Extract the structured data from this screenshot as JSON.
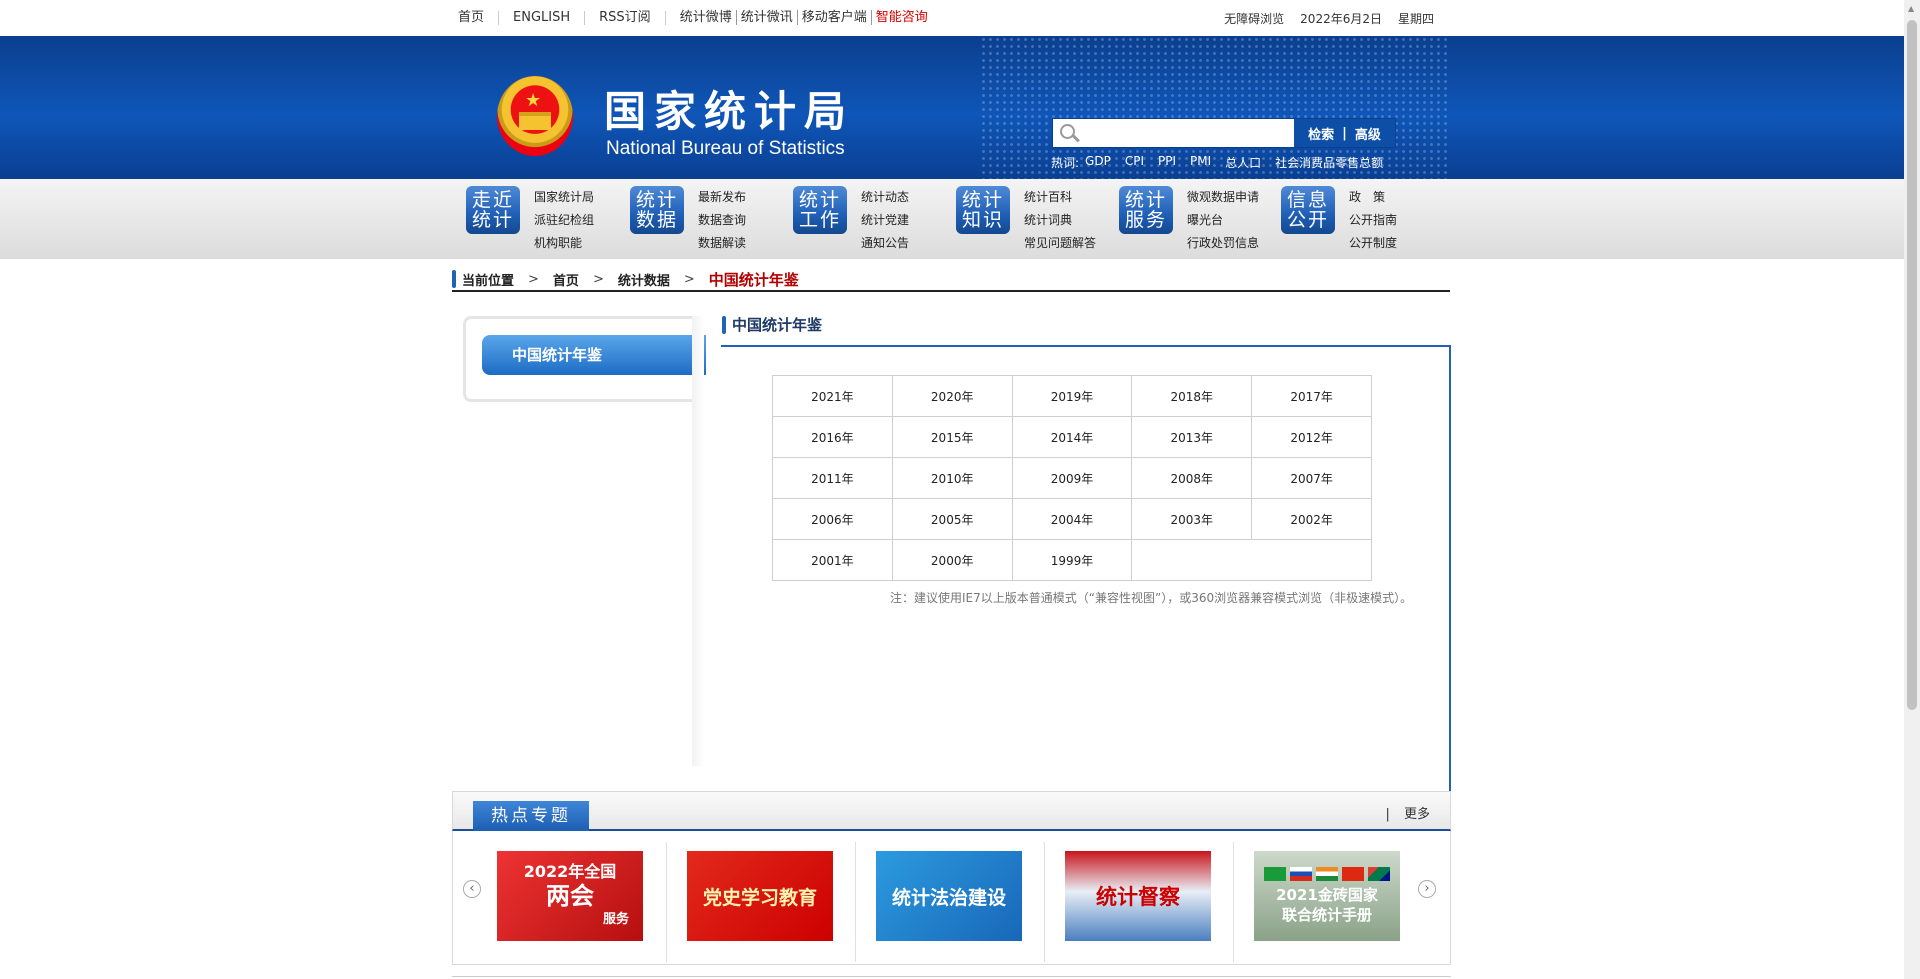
{
  "topbar": {
    "home": "首页",
    "english": "ENGLISH",
    "rss": "RSS订阅",
    "weibo": "统计微博",
    "weixin": "统计微讯",
    "mobile": "移动客户端",
    "smart": "智能咨询",
    "accessibility": "无障碍浏览",
    "date": "2022年6月2日",
    "weekday": "星期四"
  },
  "header": {
    "title": "国家统计局",
    "subtitle": "National Bureau of Statistics",
    "search_placeholder": "",
    "search_btn": "检索",
    "search_sep": "|",
    "advanced_btn": "高级",
    "hot_label": "热词:",
    "hot_words": [
      "GDP",
      "CPI",
      "PPI",
      "PMI",
      "总人口",
      "社会消费品零售总额"
    ]
  },
  "nav": [
    {
      "box": [
        "走近",
        "统计"
      ],
      "links": [
        "国家统计局",
        "派驻纪检组",
        "机构职能"
      ]
    },
    {
      "box": [
        "统计",
        "数据"
      ],
      "links": [
        "最新发布",
        "数据查询",
        "数据解读"
      ]
    },
    {
      "box": [
        "统计",
        "工作"
      ],
      "links": [
        "统计动态",
        "统计党建",
        "通知公告"
      ]
    },
    {
      "box": [
        "统计",
        "知识"
      ],
      "links": [
        "统计百科",
        "统计词典",
        "常见问题解答"
      ]
    },
    {
      "box": [
        "统计",
        "服务"
      ],
      "links": [
        "微观数据申请",
        "曝光台",
        "行政处罚信息"
      ]
    },
    {
      "box": [
        "信息",
        "公开"
      ],
      "links": [
        "政　策",
        "公开指南",
        "公开制度"
      ]
    }
  ],
  "breadcrumb": {
    "location": "当前位置",
    "home": "首页",
    "section": "统计数据",
    "current": "中国统计年鉴",
    "arrow": ">"
  },
  "sidebar": {
    "item": "中国统计年鉴"
  },
  "main": {
    "title": "中国统计年鉴",
    "years": [
      [
        "2021年",
        "2020年",
        "2019年",
        "2018年",
        "2017年"
      ],
      [
        "2016年",
        "2015年",
        "2014年",
        "2013年",
        "2012年"
      ],
      [
        "2011年",
        "2010年",
        "2009年",
        "2008年",
        "2007年"
      ],
      [
        "2006年",
        "2005年",
        "2004年",
        "2003年",
        "2002年"
      ],
      [
        "2001年",
        "2000年",
        "1999年",
        "",
        ""
      ]
    ],
    "note": "注：建议使用IE7以上版本普通模式（“兼容性视图”），或360浏览器兼容模式浏览（非极速模式）。"
  },
  "hot_topics": {
    "tab": "热点专题",
    "pipe": "|",
    "more": "更多",
    "prev": "‹",
    "next": "›",
    "slides": [
      {
        "line1": "2022年全国",
        "line2": "两会",
        "line3": "服务"
      },
      {
        "line1": "党史学习教育"
      },
      {
        "line1": "统计法治建设"
      },
      {
        "line1": "统计督察"
      },
      {
        "line1": "2021金砖国家",
        "line2": "联合统计手册"
      }
    ]
  },
  "colors": {
    "header_blue": "#0f56b8",
    "accent_red": "#b30000",
    "nav_box_blue": "#1f5fb6"
  }
}
